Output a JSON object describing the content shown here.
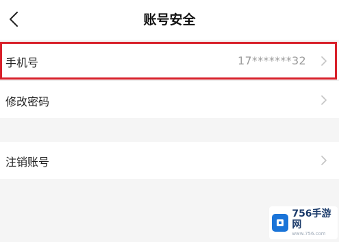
{
  "header": {
    "title": "账号安全"
  },
  "rows": [
    {
      "label": "手机号",
      "value": "17*******32"
    },
    {
      "label": "修改密码"
    },
    {
      "label": "注销账号"
    }
  ],
  "colors": {
    "highlight": "#d8202a",
    "background": "#f5f5f5",
    "row_background": "#ffffff"
  },
  "watermark": {
    "brand": "756手游网",
    "url": "www.756.com"
  }
}
